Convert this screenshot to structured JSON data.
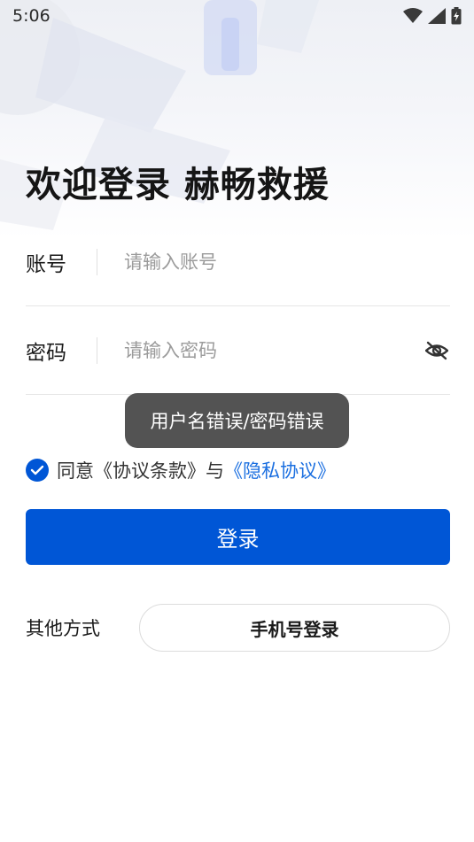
{
  "status_bar": {
    "time": "5:06",
    "icons": [
      "wifi-icon",
      "signal-icon",
      "battery-charging-icon"
    ]
  },
  "title": "欢迎登录 赫畅救援",
  "account": {
    "label": "账号",
    "placeholder": "请输入账号",
    "value": ""
  },
  "password": {
    "label": "密码",
    "placeholder": "请输入密码",
    "value": "",
    "toggle_icon": "eye-off-icon"
  },
  "toast": "用户名错误/密码错误",
  "agreement": {
    "checked": true,
    "prefix": "同意",
    "terms_link": "《协议条款》",
    "conjunction": "与",
    "privacy_link": "《隐私协议》"
  },
  "login_button": "登录",
  "other": {
    "label": "其他方式",
    "phone_login": "手机号登录"
  },
  "colors": {
    "primary": "#0056d6",
    "link": "#1b6fe0",
    "toast_bg": "#535353"
  }
}
